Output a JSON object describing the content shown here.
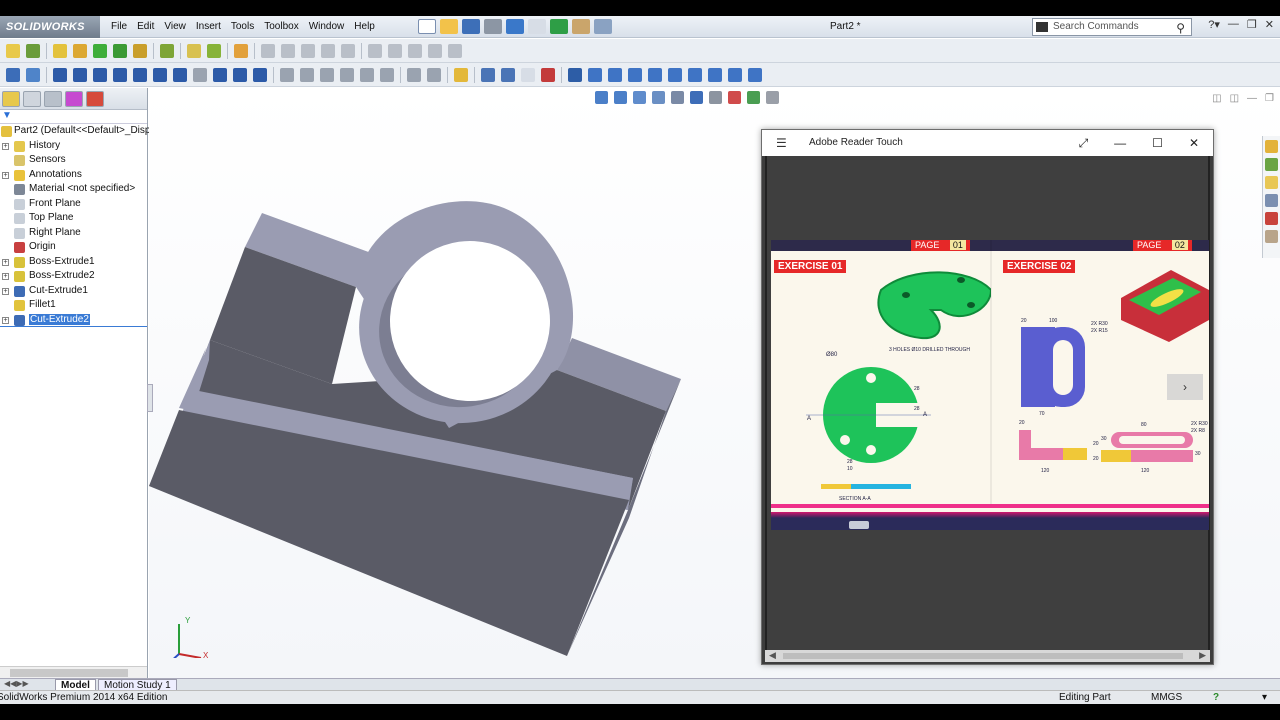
{
  "app": {
    "logo": "SOLIDWORKS",
    "document_title": "Part2 *",
    "search_placeholder": "Search Commands"
  },
  "menu": [
    "File",
    "Edit",
    "View",
    "Insert",
    "Tools",
    "Toolbox",
    "Window",
    "Help"
  ],
  "feature_tree": {
    "root": "Part2  (Default<<Default>_Disp",
    "items": [
      {
        "label": "History",
        "icon": "history-icon",
        "expandable": true
      },
      {
        "label": "Sensors",
        "icon": "sensor-icon",
        "expandable": false
      },
      {
        "label": "Annotations",
        "icon": "annotations-icon",
        "expandable": true
      },
      {
        "label": "Material <not specified>",
        "icon": "material-icon",
        "expandable": false
      },
      {
        "label": "Front Plane",
        "icon": "plane-icon",
        "expandable": false
      },
      {
        "label": "Top Plane",
        "icon": "plane-icon",
        "expandable": false
      },
      {
        "label": "Right Plane",
        "icon": "plane-icon",
        "expandable": false
      },
      {
        "label": "Origin",
        "icon": "origin-icon",
        "expandable": false
      },
      {
        "label": "Boss-Extrude1",
        "icon": "extrude-icon",
        "expandable": true
      },
      {
        "label": "Boss-Extrude2",
        "icon": "extrude-icon",
        "expandable": true
      },
      {
        "label": "Cut-Extrude1",
        "icon": "cut-extrude-icon",
        "expandable": true
      },
      {
        "label": "Fillet1",
        "icon": "fillet-icon",
        "expandable": false
      },
      {
        "label": "Cut-Extrude2",
        "icon": "cut-extrude-icon",
        "expandable": true,
        "selected": true
      }
    ]
  },
  "bottom_tabs": [
    "Model",
    "Motion Study 1"
  ],
  "status": {
    "edition": "SolidWorks Premium 2014 x64 Edition",
    "mode": "Editing Part",
    "units": "MMGS",
    "help": "?"
  },
  "triad": {
    "y": "Y",
    "x": "X"
  },
  "adobe": {
    "title": "Adobe Reader Touch",
    "page1": {
      "tag": "PAGE",
      "num": "01",
      "exercise": "EXERCISE 01",
      "note": "3 HOLES Ø10 DRILLED THROUGH",
      "dia": "Ø80",
      "section": "SECTION A-A",
      "dims": [
        "28",
        "28",
        "28",
        "10"
      ],
      "cut": "A"
    },
    "page2": {
      "tag": "PAGE",
      "num": "02",
      "exercise": "EXERCISE 02",
      "dims": [
        "100",
        "20",
        "2X R30",
        "2X R15",
        "70",
        "20",
        "120",
        "80",
        "2X R30",
        "2X R8",
        "30",
        "30",
        "20",
        "20",
        "120"
      ]
    }
  },
  "colors": {
    "part_dark": "#5a5b66",
    "part_light": "#9a9cb2",
    "part_mid": "#7c7e92",
    "selection": "#3a7bd5",
    "exercise_red": "#e62828",
    "drawing_green": "#1ec35a"
  }
}
